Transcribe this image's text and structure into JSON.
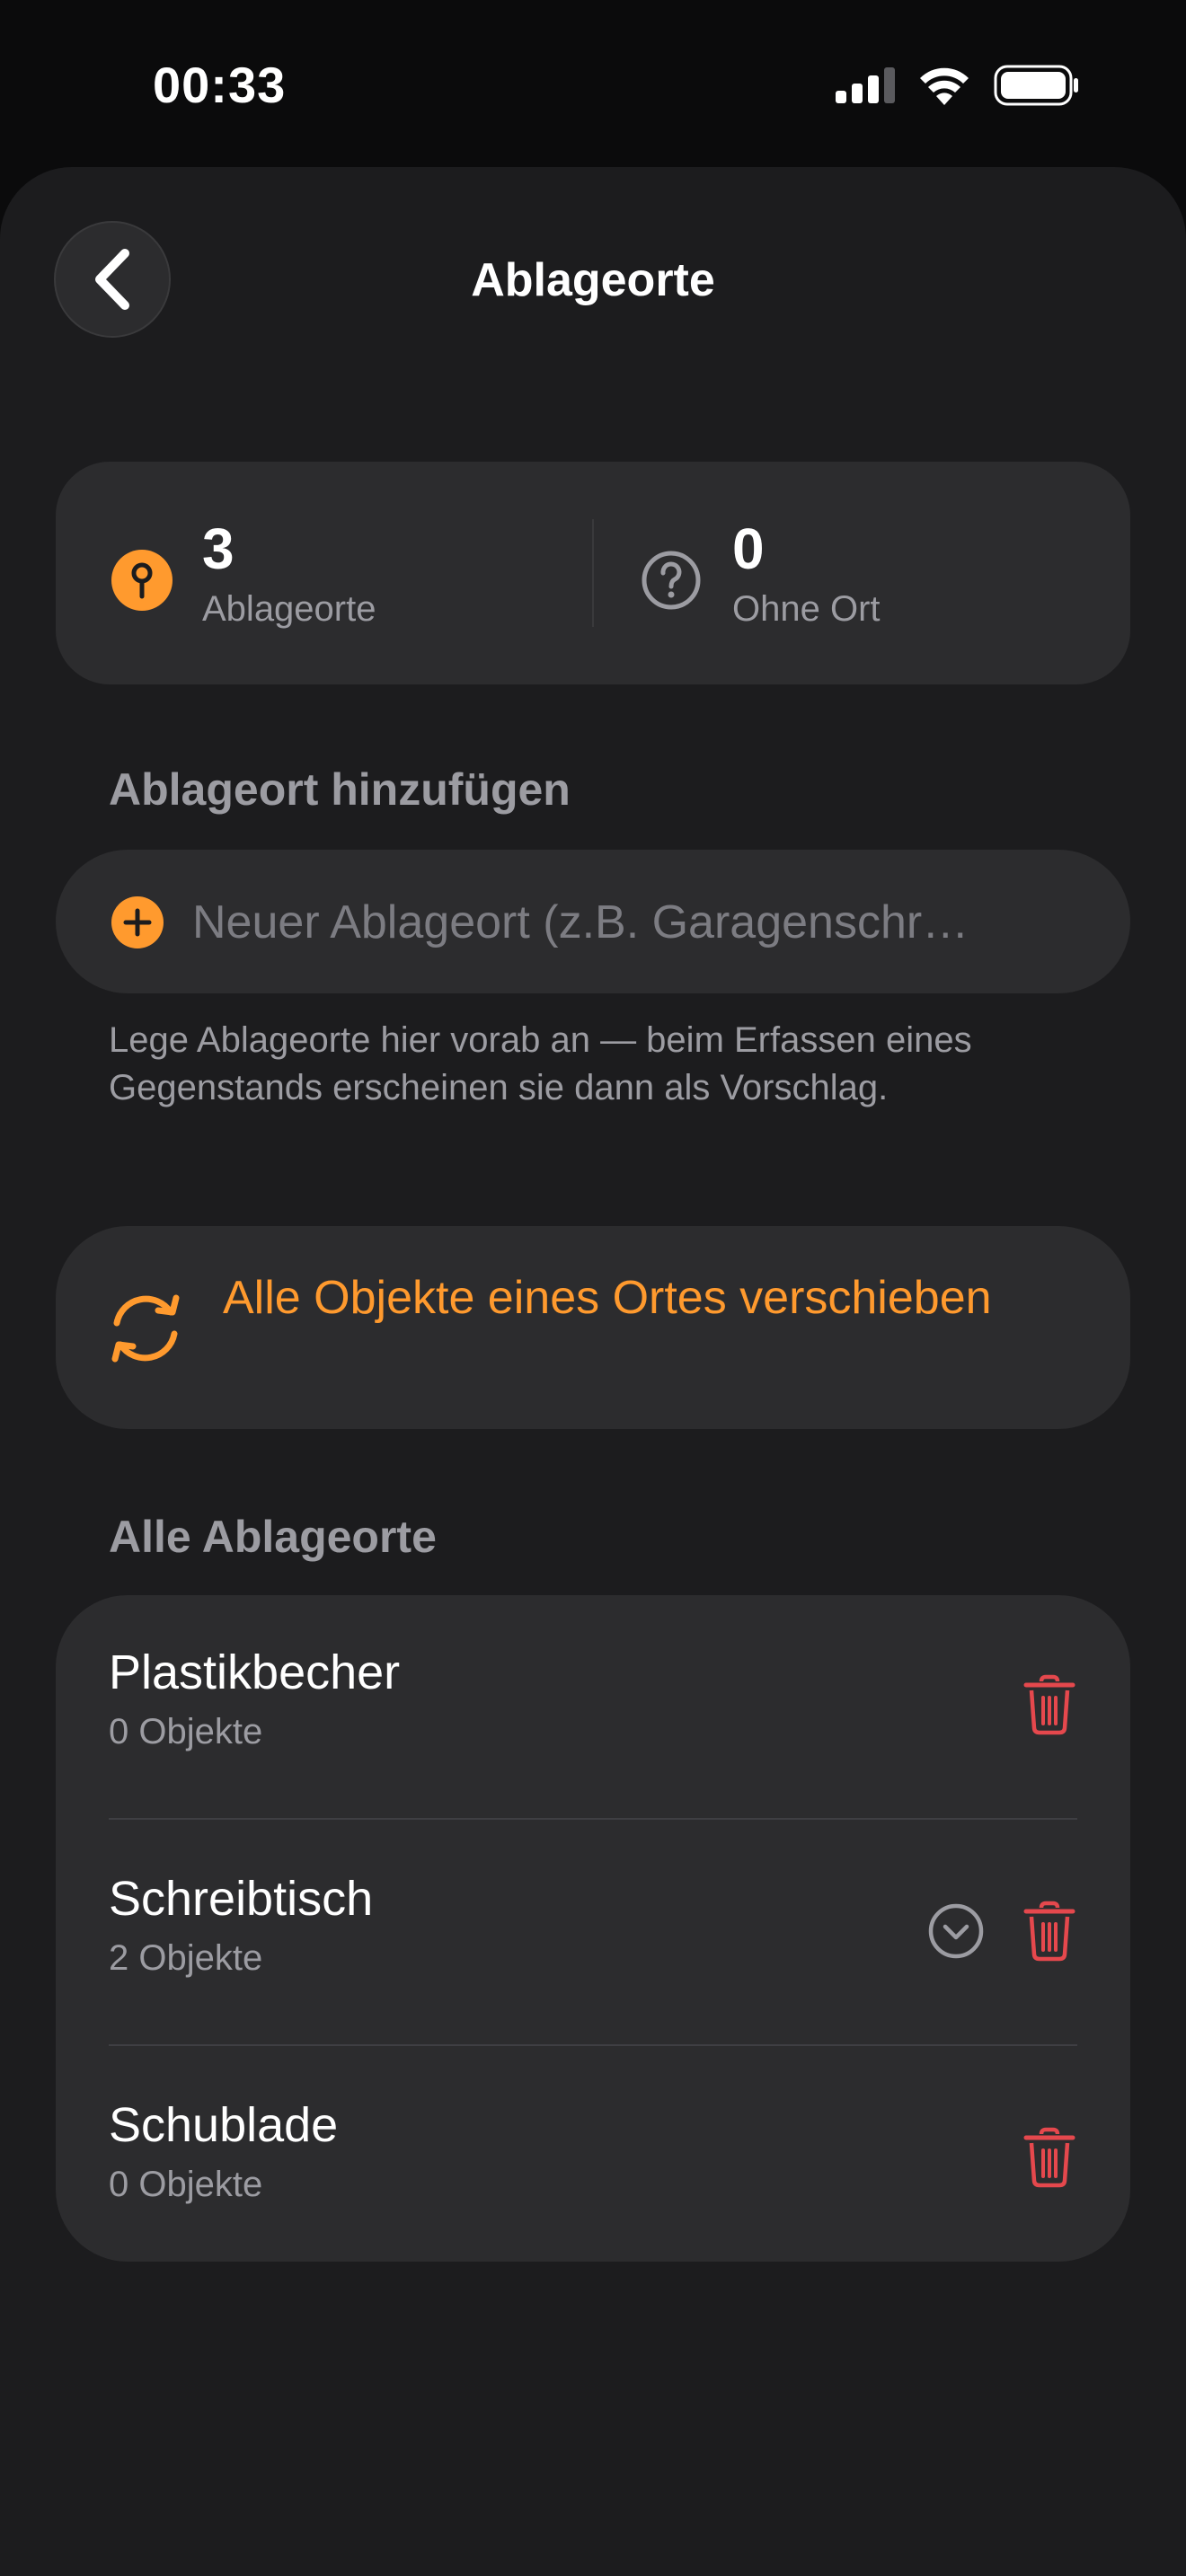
{
  "status_bar": {
    "time": "00:33"
  },
  "nav": {
    "title": "Ablageorte",
    "back_icon": "chevron-left-icon"
  },
  "stats": {
    "locations": {
      "value": "3",
      "label": "Ablageorte",
      "icon": "pin-icon"
    },
    "unassigned": {
      "value": "0",
      "label": "Ohne Ort",
      "icon": "question-circle-icon"
    }
  },
  "add_section": {
    "heading": "Ablageort hinzufügen",
    "placeholder": "Neuer Ablageort (z.B. Garagenschr…",
    "hint": "Lege Ablageorte hier vorab an — beim Erfassen eines Gegenstands erscheinen sie dann als Vorschlag."
  },
  "move_action": {
    "label": "Alle Objekte eines Ortes verschieben",
    "icon": "arrows-cycle-icon"
  },
  "list_section": {
    "heading": "Alle Ablageorte",
    "items": [
      {
        "name": "Plastikbecher",
        "count": "0 Objekte",
        "expandable": false
      },
      {
        "name": "Schreibtisch",
        "count": "2 Objekte",
        "expandable": true
      },
      {
        "name": "Schublade",
        "count": "0 Objekte",
        "expandable": false
      }
    ]
  },
  "colors": {
    "accent": "#ff9a2e",
    "destructive": "#e5484d",
    "background": "#1c1c1e",
    "card": "#2c2c2e",
    "secondary_text": "#9c9ca2"
  }
}
